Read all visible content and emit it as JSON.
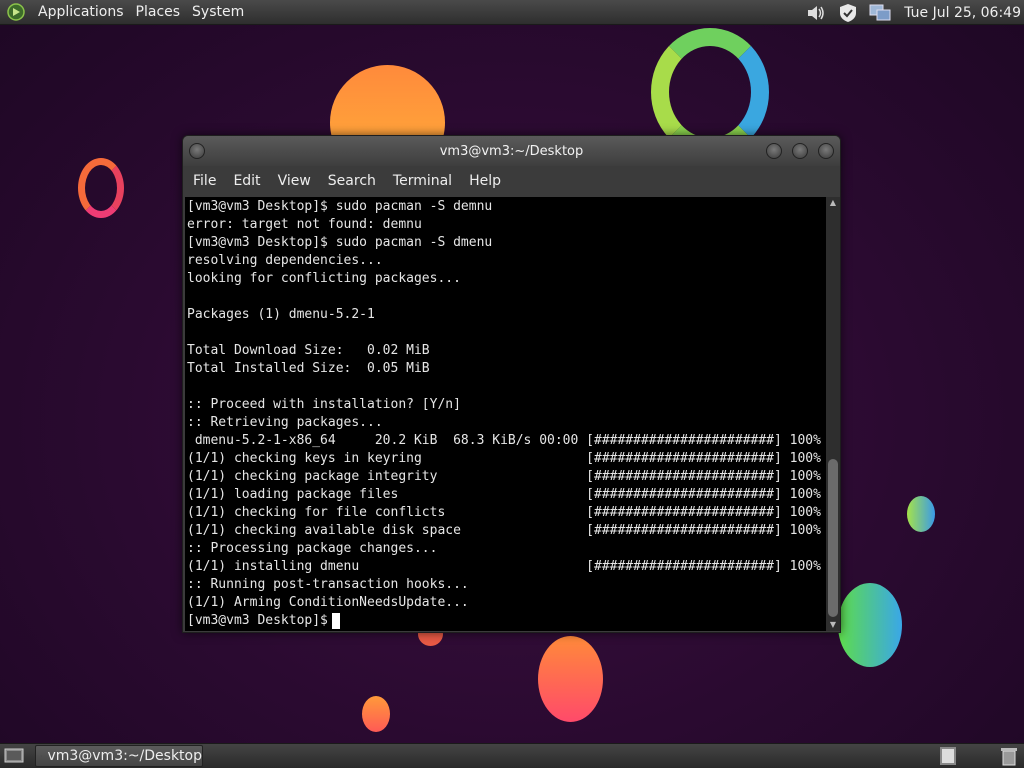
{
  "top_panel": {
    "menus": [
      "Applications",
      "Places",
      "System"
    ],
    "clock": "Tue Jul 25, 06:49",
    "tray_icons": [
      "volume-icon",
      "shield-icon",
      "network-icon"
    ]
  },
  "window": {
    "title": "vm3@vm3:~/Desktop",
    "menu": [
      "File",
      "Edit",
      "View",
      "Search",
      "Terminal",
      "Help"
    ],
    "terminal_lines": [
      "[vm3@vm3 Desktop]$ sudo pacman -S demnu",
      "error: target not found: demnu",
      "[vm3@vm3 Desktop]$ sudo pacman -S dmenu",
      "resolving dependencies...",
      "looking for conflicting packages...",
      "",
      "Packages (1) dmenu-5.2-1",
      "",
      "Total Download Size:   0.02 MiB",
      "Total Installed Size:  0.05 MiB",
      "",
      ":: Proceed with installation? [Y/n]",
      ":: Retrieving packages...",
      " dmenu-5.2-1-x86_64     20.2 KiB  68.3 KiB/s 00:00 [#######################] 100%",
      "(1/1) checking keys in keyring                     [#######################] 100%",
      "(1/1) checking package integrity                   [#######################] 100%",
      "(1/1) loading package files                        [#######################] 100%",
      "(1/1) checking for file conflicts                  [#######################] 100%",
      "(1/1) checking available disk space                [#######################] 100%",
      ":: Processing package changes...",
      "(1/1) installing dmenu                             [#######################] 100%",
      ":: Running post-transaction hooks...",
      "(1/1) Arming ConditionNeedsUpdate..."
    ],
    "prompt": "[vm3@vm3 Desktop]$"
  },
  "taskbar": {
    "task_label": "vm3@vm3:~/Desktop"
  },
  "colors": {
    "terminal_bg": "#000000",
    "terminal_fg": "#e6e6e6",
    "panel_bg": "#3a3a3a"
  }
}
